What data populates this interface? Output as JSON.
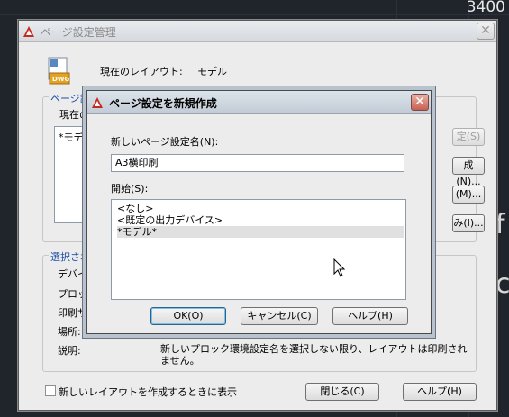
{
  "background": {
    "coordinate": "3400"
  },
  "outer_dialog": {
    "title": "ページ設定管理",
    "current_layout_label": "現在のレイアウト:",
    "current_layout_value": "モデル",
    "group_page_setup_legend": "ページ設",
    "current_page_setup_label": "現在の",
    "list_first_item": "*モデ",
    "set_current_button": "定(S)",
    "new_button": "成(N)...",
    "modify_button": "(M)...",
    "import_button": "み(I)...",
    "group_selected_legend": "選択され",
    "detail_rows": [
      "デバイス",
      "プロッタ",
      "印刷サ",
      "場所:",
      "説明:"
    ],
    "description_value": "新しいプロック環境設定名を選択しない限り、レイアウトは印刷されません。",
    "show_on_new_layout_label": "新しいレイアウトを作成するときに表示",
    "close_button": "閉じる(C)",
    "help_button": "ヘルプ(H)"
  },
  "inner_dialog": {
    "title": "ページ設定を新規作成",
    "new_name_label": "新しいページ設定名(N):",
    "new_name_value": "A3横印刷",
    "start_with_label": "開始(S):",
    "start_with_options": [
      "<なし>",
      "<既定の出力デバイス>",
      "*モデル*"
    ],
    "selected_option_index": 2,
    "ok_button": "OK(O)",
    "cancel_button": "キャンセル(C)",
    "help_button": "ヘルプ(H)"
  },
  "colors": {
    "accent_legend": "#1a4fa8",
    "close_red": "#c86050"
  }
}
